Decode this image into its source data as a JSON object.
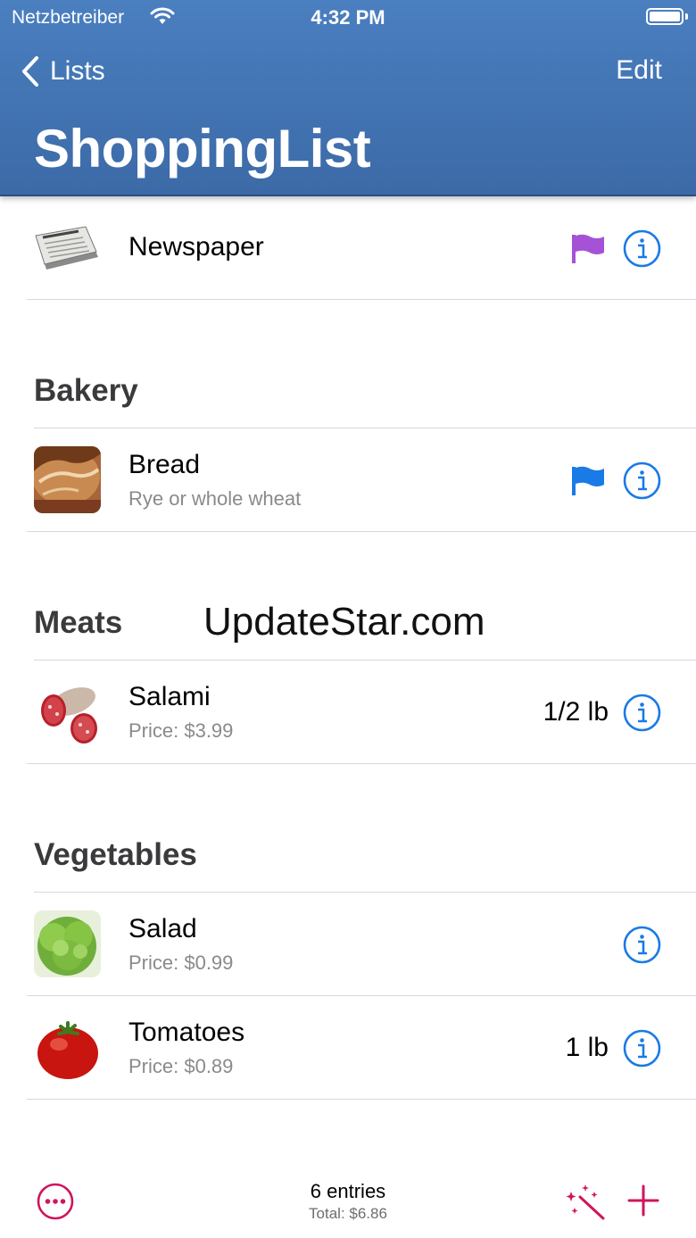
{
  "status": {
    "carrier": "Netzbetreiber",
    "time": "4:32 PM"
  },
  "nav": {
    "back_label": "Lists",
    "edit_label": "Edit",
    "title": "ShoppingList"
  },
  "colors": {
    "header_blue": "#3f70ad",
    "link_blue": "#1a7ae6",
    "accent_pink": "#d0155c",
    "flag_purple": "#a552d6",
    "flag_blue": "#1a7ae6"
  },
  "items": [
    {
      "name": "Newspaper",
      "flag": "purple",
      "icon": "newspaper-thumbnail"
    },
    {
      "name": "Bread",
      "subtitle": "Rye or whole wheat",
      "flag": "blue",
      "icon": "bread-thumbnail"
    },
    {
      "name": "Salami",
      "subtitle": "Price: $3.99",
      "quantity": "1/2 lb",
      "icon": "salami-thumbnail"
    },
    {
      "name": "Salad",
      "subtitle": "Price: $0.99",
      "icon": "salad-thumbnail"
    },
    {
      "name": "Tomatoes",
      "subtitle": "Price: $0.89",
      "quantity": "1 lb",
      "icon": "tomato-thumbnail"
    }
  ],
  "sections": {
    "bakery": "Bakery",
    "meats": "Meats",
    "vegetables": "Vegetables"
  },
  "watermark": "UpdateStar.com",
  "footer": {
    "entries": "6 entries",
    "total": "Total: $6.86"
  }
}
